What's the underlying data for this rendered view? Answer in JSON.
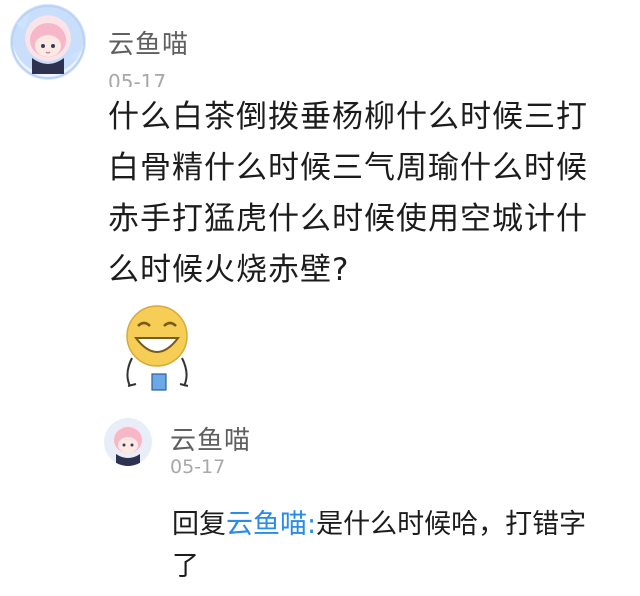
{
  "post": {
    "author": "云鱼喵",
    "date": "05-17",
    "text": "什么白茶倒拨垂杨柳什么时候三打白骨精什么时候三气周瑜什么时候赤手打猛虎什么时候使用空城计什么时候火烧赤壁?"
  },
  "sticker": {
    "icon": "laughing-face-sticker"
  },
  "reply": {
    "author": "云鱼喵",
    "date": "05-17",
    "prefix": "回复",
    "mention": "云鱼喵:",
    "text": "是什么时候哈，打错字了",
    "mention_color": "#2a8be8"
  }
}
